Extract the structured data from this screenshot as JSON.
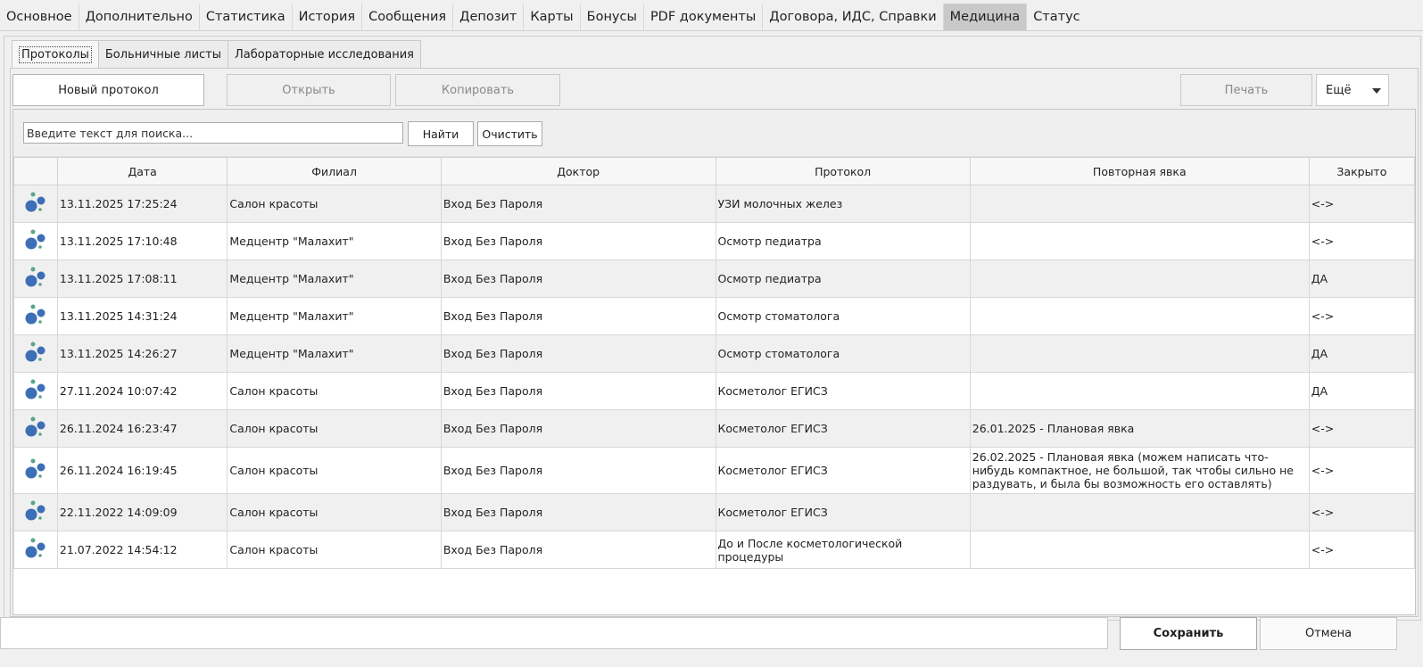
{
  "top_tabs": [
    "Основное",
    "Дополнительно",
    "Статистика",
    "История",
    "Сообщения",
    "Депозит",
    "Карты",
    "Бонусы",
    "PDF документы",
    "Договора, ИДС, Справки",
    "Медицина",
    "Статус"
  ],
  "sub_tabs": [
    "Протоколы",
    "Больничные листы",
    "Лабораторные исследования"
  ],
  "toolbar": {
    "new_protocol": "Новый протокол",
    "open": "Открыть",
    "copy": "Копировать",
    "print": "Печать",
    "more": "Ещё"
  },
  "search": {
    "placeholder": "Введите текст для поиска...",
    "find": "Найти",
    "clear": "Очистить"
  },
  "columns": [
    "Дата",
    "Филиал",
    "Доктор",
    "Протокол",
    "Повторная явка",
    "Закрыто"
  ],
  "rows": [
    {
      "date": "13.11.2025 17:25:24",
      "branch": "Салон красоты",
      "doctor": "Вход Без Пароля",
      "protocol": "УЗИ молочных желез",
      "revisit": "",
      "closed": "<->"
    },
    {
      "date": "13.11.2025 17:10:48",
      "branch": "Медцентр \"Малахит\"",
      "doctor": "Вход Без Пароля",
      "protocol": "Осмотр  педиатра",
      "revisit": "",
      "closed": "<->"
    },
    {
      "date": "13.11.2025 17:08:11",
      "branch": "Медцентр \"Малахит\"",
      "doctor": "Вход Без Пароля",
      "protocol": "Осмотр  педиатра",
      "revisit": "",
      "closed": "ДА"
    },
    {
      "date": "13.11.2025 14:31:24",
      "branch": "Медцентр \"Малахит\"",
      "doctor": "Вход Без Пароля",
      "protocol": "Осмотр стоматолога",
      "revisit": "",
      "closed": "<->"
    },
    {
      "date": "13.11.2025 14:26:27",
      "branch": "Медцентр \"Малахит\"",
      "doctor": "Вход Без Пароля",
      "protocol": "Осмотр стоматолога",
      "revisit": "",
      "closed": "ДА"
    },
    {
      "date": "27.11.2024 10:07:42",
      "branch": "Салон красоты",
      "doctor": "Вход Без Пароля",
      "protocol": "Косметолог ЕГИСЗ",
      "revisit": "",
      "closed": "ДА"
    },
    {
      "date": "26.11.2024 16:23:47",
      "branch": "Салон красоты",
      "doctor": "Вход Без Пароля",
      "protocol": "Косметолог ЕГИСЗ",
      "revisit": "26.01.2025 - Плановая явка",
      "closed": "<->"
    },
    {
      "date": "26.11.2024 16:19:45",
      "branch": "Салон красоты",
      "doctor": "Вход Без Пароля",
      "protocol": "Косметолог ЕГИСЗ",
      "revisit": "26.02.2025 - Плановая явка (можем написать что-нибудь компактное, не большой, так чтобы сильно не раздувать, и была бы возможность его оставлять)",
      "closed": "<->"
    },
    {
      "date": "22.11.2022 14:09:09",
      "branch": "Салон красоты",
      "doctor": "Вход Без Пароля",
      "protocol": "Косметолог ЕГИСЗ",
      "revisit": "",
      "closed": "<->"
    },
    {
      "date": "21.07.2022 14:54:12",
      "branch": "Салон красоты",
      "doctor": "Вход Без Пароля",
      "protocol": "До и После косметологической процедуры",
      "revisit": "",
      "closed": "<->"
    }
  ],
  "footer": {
    "save": "Сохранить",
    "cancel": "Отмена"
  },
  "colors": {
    "active_tab": "#c9c9c9",
    "bubble_blue": "#3c6fb5",
    "bubble_green": "#5aa58a"
  },
  "row_icon": "bubbles-icon"
}
